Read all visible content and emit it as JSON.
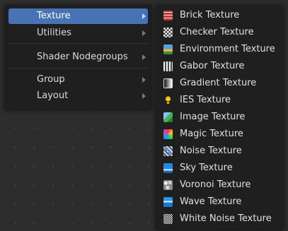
{
  "menu": {
    "items": [
      {
        "label": "Texture",
        "active": true
      },
      {
        "label": "Utilities"
      },
      {
        "label": "Shader Nodegroups"
      },
      {
        "label": "Group"
      },
      {
        "label": "Layout"
      }
    ],
    "accent_color": "#4772b3"
  },
  "submenu": {
    "items": [
      {
        "label": "Brick Texture",
        "icon": "brick-texture-icon"
      },
      {
        "label": "Checker Texture",
        "icon": "checker-texture-icon"
      },
      {
        "label": "Environment Texture",
        "icon": "environment-texture-icon"
      },
      {
        "label": "Gabor Texture",
        "icon": "gabor-texture-icon"
      },
      {
        "label": "Gradient Texture",
        "icon": "gradient-texture-icon"
      },
      {
        "label": "IES Texture",
        "icon": "ies-light-icon"
      },
      {
        "label": "Image Texture",
        "icon": "image-texture-icon"
      },
      {
        "label": "Magic Texture",
        "icon": "magic-texture-icon"
      },
      {
        "label": "Noise Texture",
        "icon": "noise-texture-icon"
      },
      {
        "label": "Sky Texture",
        "icon": "sky-texture-icon"
      },
      {
        "label": "Voronoi Texture",
        "icon": "voronoi-texture-icon"
      },
      {
        "label": "Wave Texture",
        "icon": "wave-texture-icon"
      },
      {
        "label": "White Noise Texture",
        "icon": "white-noise-texture-icon"
      }
    ]
  }
}
